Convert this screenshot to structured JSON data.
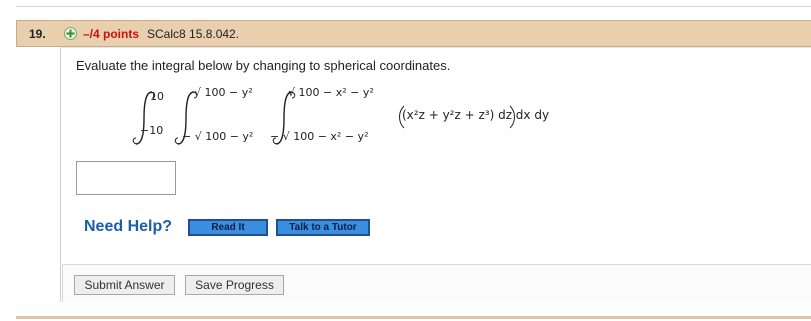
{
  "question": {
    "number": "19.",
    "points": "–/4 points",
    "source": "SCalc8 15.8.042.",
    "prompt": "Evaluate the integral below by changing to spherical coordinates."
  },
  "integral": {
    "outer_upper": "10",
    "outer_lower": "−10",
    "mid_upper": "√ 100 − y²",
    "mid_lower": "− √ 100 − y²",
    "inner_upper": "√ 100 − x² − y²",
    "inner_lower": "− √ 100 − x² − y²",
    "integrand": "(x²z + y²z + z³) dz dx dy"
  },
  "answer_field": {
    "value": ""
  },
  "help": {
    "label": "Need Help?",
    "read_it": "Read It",
    "talk_to_tutor": "Talk to a Tutor"
  },
  "actions": {
    "submit": "Submit Answer",
    "save": "Save Progress"
  },
  "colors": {
    "header_bg": "#e9cfae",
    "points_red": "#cc1111",
    "help_blue": "#1a5ea8",
    "button_blue": "#3c8ee0"
  }
}
